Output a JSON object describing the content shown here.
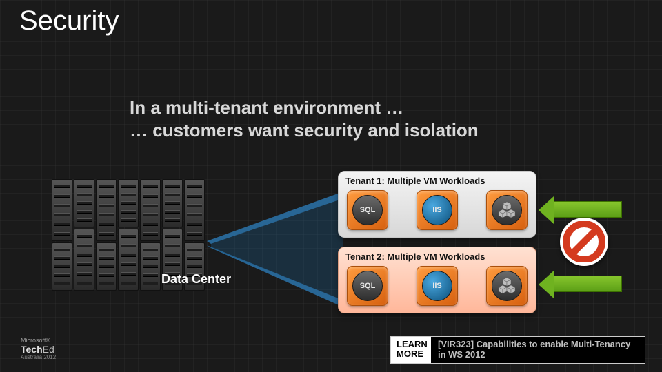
{
  "title": "Security",
  "subhead": {
    "line1": "In a multi-tenant environment …",
    "line2": "… customers want security and isolation"
  },
  "datacenter_label": "Data Center",
  "tenants": [
    {
      "title": "Tenant 1: Multiple VM Workloads",
      "vms": [
        "SQL",
        "IIS",
        "cubes"
      ]
    },
    {
      "title": "Tenant 2: Multiple VM Workloads",
      "vms": [
        "SQL",
        "IIS",
        "cubes"
      ]
    }
  ],
  "learn_more": {
    "button": "LEARN MORE",
    "desc": "[VIR323] Capabilities to enable Multi-Tenancy in WS 2012"
  },
  "footer": {
    "brand": "Microsoft®",
    "event_prefix": "Tech",
    "event_suffix": "Ed",
    "sub": "Australia 2012"
  },
  "icons": {
    "prohibit": "no-entry-icon",
    "arrow": "green-arrow-left-icon",
    "server_rack": "server-rack-icon",
    "vm_sql": "sql-vm-icon",
    "vm_iis": "iis-vm-icon",
    "vm_cubes": "cubes-vm-icon"
  },
  "colors": {
    "tenant1_bg": "#e8e8e8",
    "tenant2_bg": "#ffc4a8",
    "arrow": "#74b81f",
    "prohibit": "#d43a1f"
  }
}
